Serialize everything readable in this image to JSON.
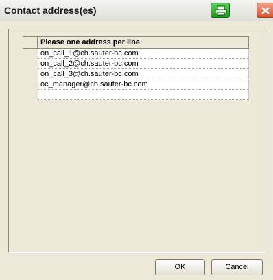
{
  "window": {
    "title": "Contact address(es)"
  },
  "titlebar_buttons": {
    "print_icon": "printer-icon",
    "close_icon": "close-icon"
  },
  "table": {
    "column_header": "Please one address per line",
    "rows": [
      "on_call_1@ch.sauter-bc.com",
      "on_call_2@ch.sauter-bc.com",
      "on_call_3@ch.sauter-bc.com",
      "oc_manager@ch.sauter-bc.com",
      ""
    ]
  },
  "buttons": {
    "ok_label": "OK",
    "cancel_label": "Cancel"
  },
  "colors": {
    "dialog_background": "#ece9d8",
    "print_button": "#2fb32f",
    "close_button": "#d6542e"
  }
}
